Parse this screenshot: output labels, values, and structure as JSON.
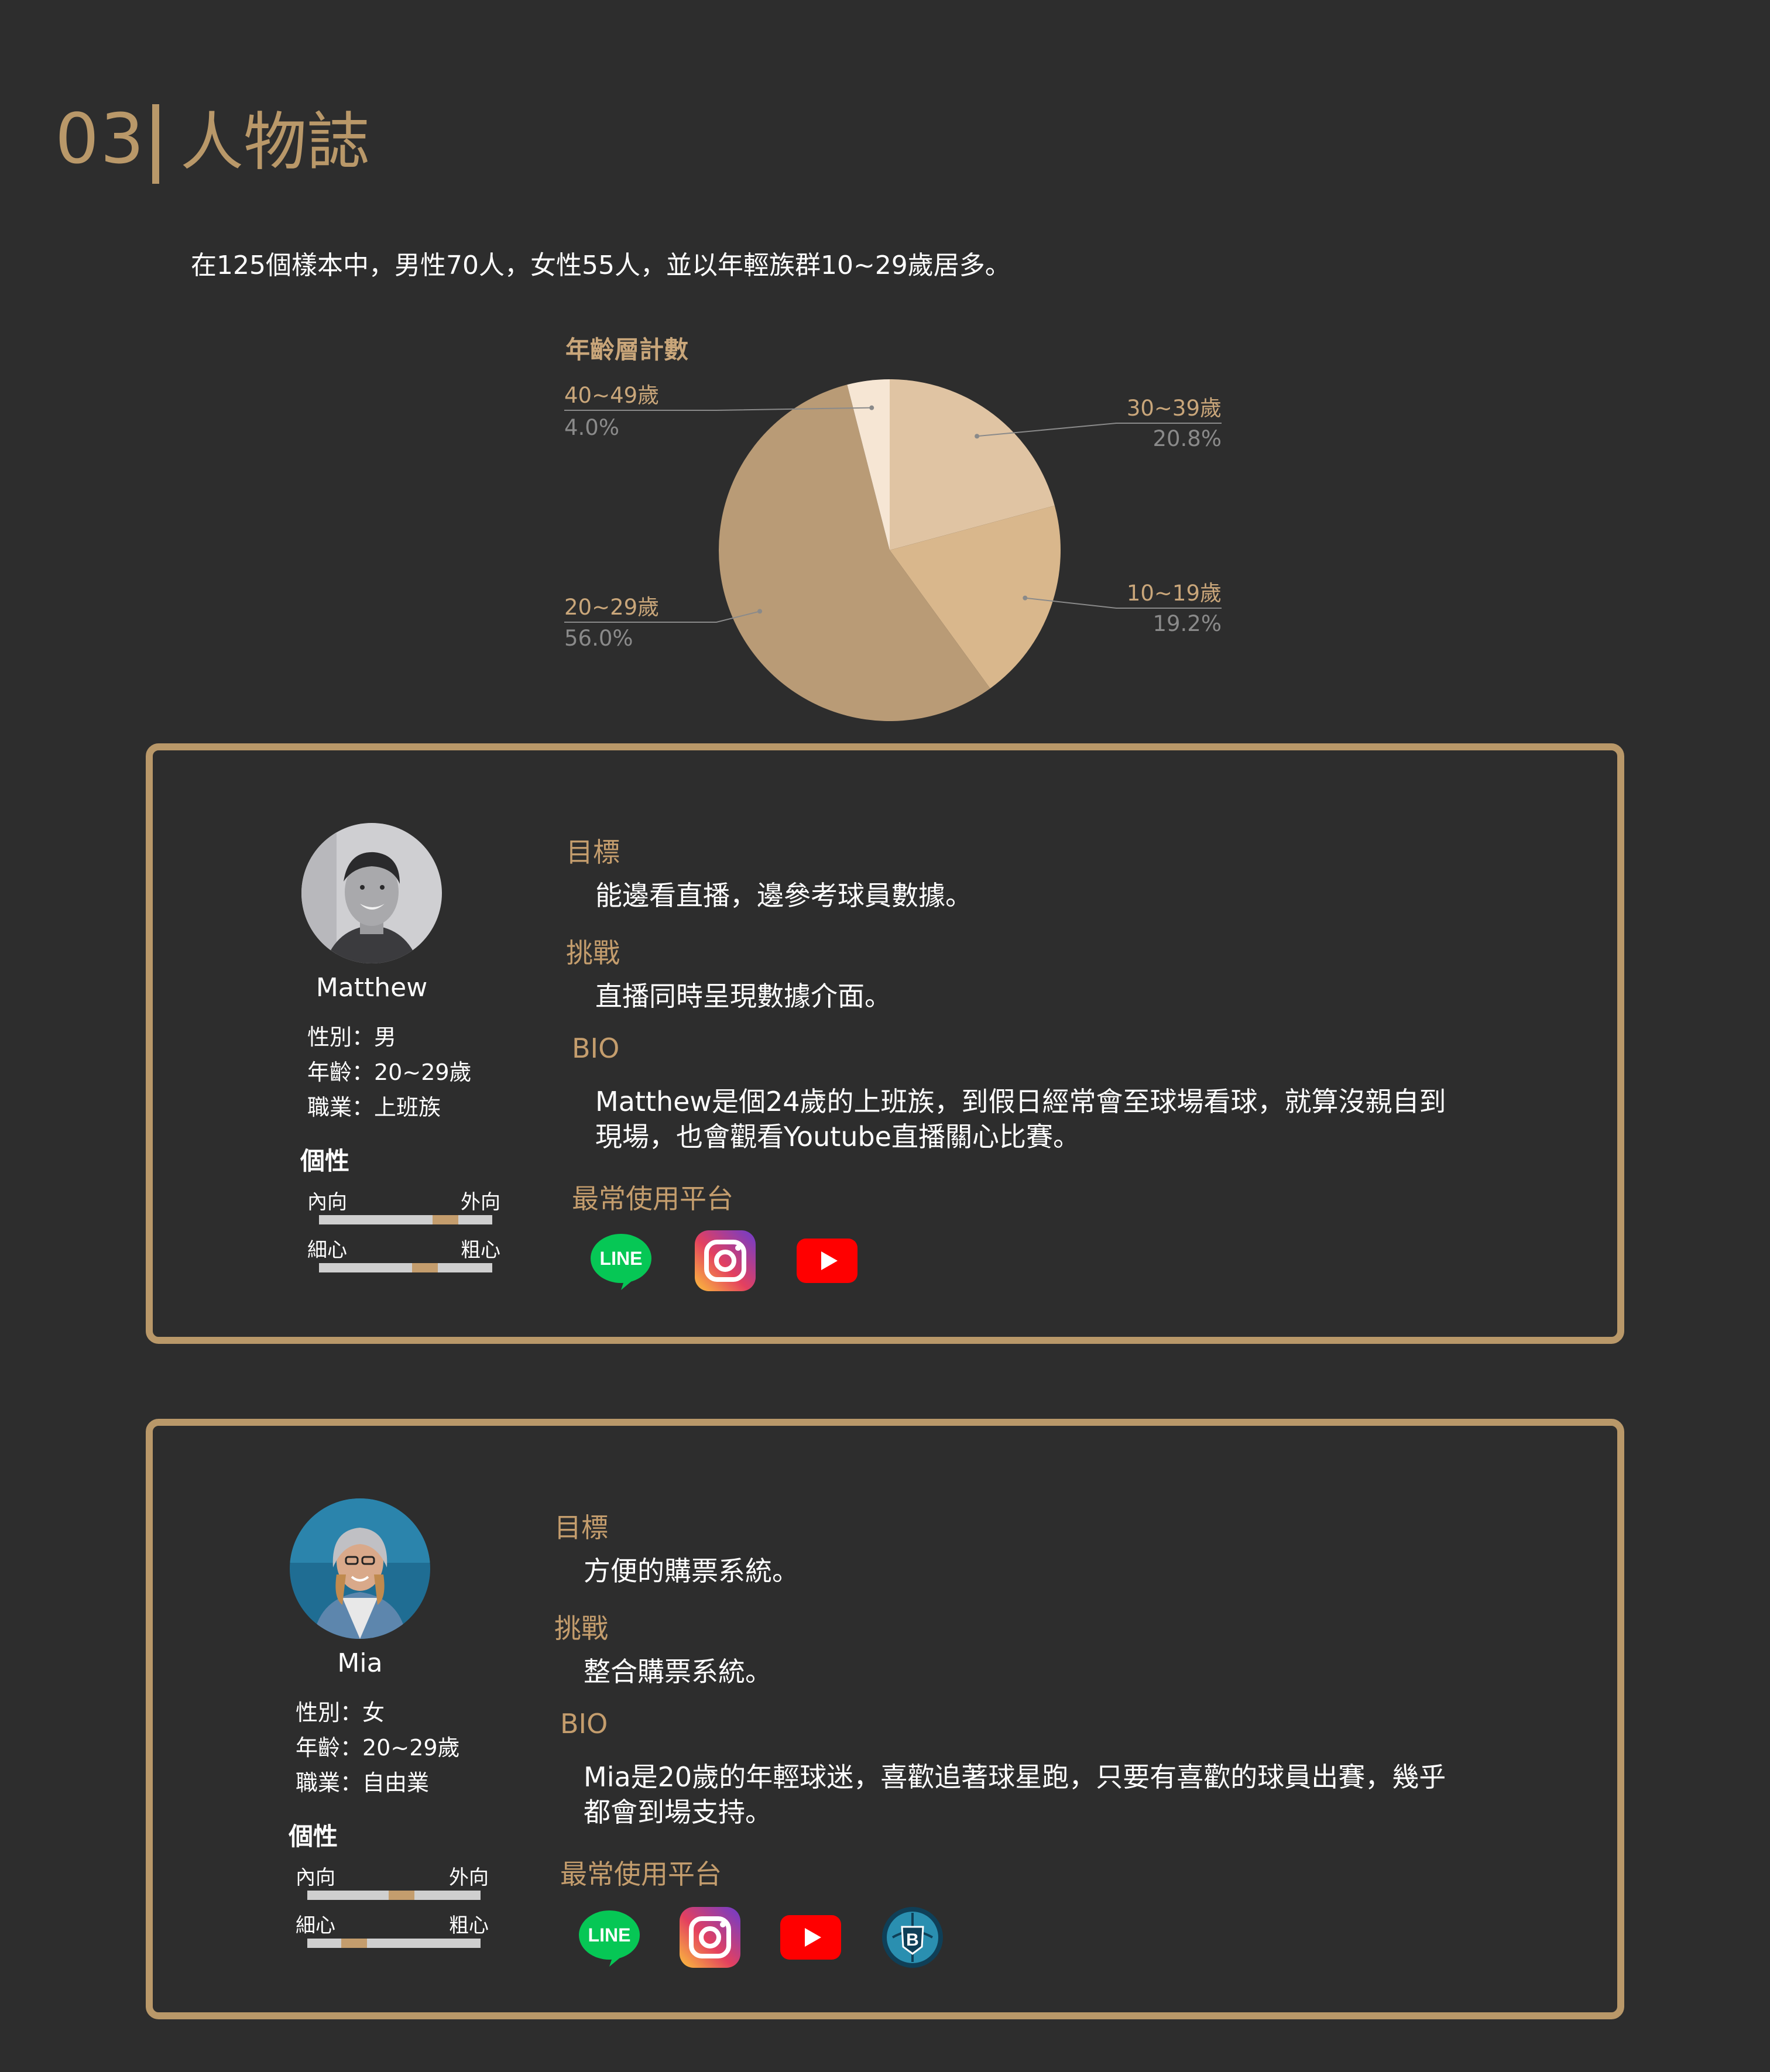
{
  "header": {
    "number": "03",
    "title": "人物誌"
  },
  "intro": "在125個樣本中，男性70人，女性55人，並以年輕族群10~29歲居多。",
  "chart_data": {
    "type": "pie",
    "title": "年齡層計數",
    "slices": [
      {
        "label": "30~39歲",
        "value": 20.8,
        "pct": "20.8%",
        "color": "#e0c4a3"
      },
      {
        "label": "10~19歲",
        "value": 19.2,
        "pct": "19.2%",
        "color": "#d9b78c"
      },
      {
        "label": "20~29歲",
        "value": 56.0,
        "pct": "56.0%",
        "color": "#b99b76"
      },
      {
        "label": "40~49歲",
        "value": 4.0,
        "pct": "4.0%",
        "color": "#f6e6d4"
      }
    ]
  },
  "personas": [
    {
      "name": "Matthew",
      "gender": "性別：男",
      "age": "年齡：20~29歲",
      "job": "職業：上班族",
      "personality_title": "個性",
      "scale1": {
        "left": "內向",
        "right": "外向",
        "value": 0.77
      },
      "scale2": {
        "left": "細心",
        "right": "粗心",
        "value": 0.63
      },
      "goal_h": "目標",
      "goal": "能邊看直播，邊參考球員數據。",
      "challenge_h": "挑戰",
      "challenge": "直播同時呈現數據介面。",
      "bio_h": "BIO",
      "bio_1": "Matthew是個24歲的上班族，到假日經常會至球場看球，就算沒親自到",
      "bio_2": "現場，也會觀看Youtube直播關心比賽。",
      "platform_h": "最常使用平台",
      "platforms": [
        "line-icon",
        "instagram-icon",
        "youtube-icon"
      ]
    },
    {
      "name": "Mia",
      "gender": "性別：女",
      "age": "年齡：20~29歲",
      "job": "職業：自由業",
      "personality_title": "個性",
      "scale1": {
        "left": "內向",
        "right": "外向",
        "value": 0.55
      },
      "scale2": {
        "left": "細心",
        "right": "粗心",
        "value": 0.23
      },
      "goal_h": "目標",
      "goal": "方便的購票系統。",
      "challenge_h": "挑戰",
      "challenge": "整合購票系統。",
      "bio_h": "BIO",
      "bio_1": "Mia是20歲的年輕球迷，喜歡追著球星跑，只要有喜歡的球員出賽，幾乎",
      "bio_2": "都會到場支持。",
      "platform_h": "最常使用平台",
      "platforms": [
        "line-icon",
        "instagram-icon",
        "youtube-icon",
        "team-app-icon"
      ],
      "team_app_letter": "B"
    }
  ]
}
